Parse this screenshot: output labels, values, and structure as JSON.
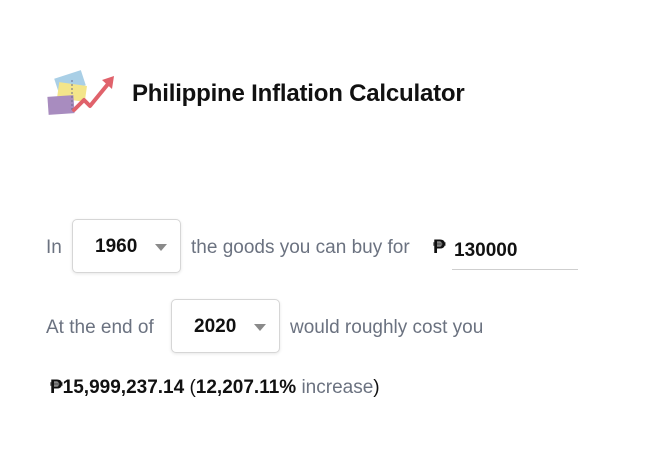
{
  "header": {
    "title": "Philippine Inflation Calculator",
    "logo_icon": "inflation-chart-icon"
  },
  "calculator": {
    "line1": {
      "prefix": "In",
      "from_year": "1960",
      "middle": "the goods you can buy for",
      "currency_symbol": "₱",
      "amount": "130000"
    },
    "line2": {
      "prefix": "At the end of",
      "to_year": "2020",
      "suffix": "would roughly cost you"
    },
    "result": {
      "value": "₱15,999,237.14",
      "open_paren": " (",
      "percent": "12,207.11%",
      "increase_label": " increase",
      "close_paren": ")"
    }
  },
  "colors": {
    "text": "#111111",
    "muted": "#6b7280",
    "arrow": "#e0626b"
  }
}
